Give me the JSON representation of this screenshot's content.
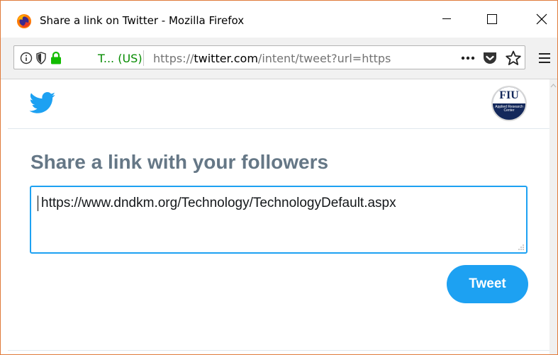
{
  "window": {
    "title": "Share a link on Twitter - Mozilla Firefox"
  },
  "navbar": {
    "site_identity": "T... (US)",
    "url_scheme": "https://",
    "url_host": "twitter.com",
    "url_path": "/intent/tweet?url=https",
    "icons": [
      "info-icon",
      "tracking-shield-icon",
      "lock-icon",
      "more-actions-icon",
      "pocket-icon",
      "bookmark-star-icon",
      "hamburger-menu-icon"
    ]
  },
  "page": {
    "logo": "twitter-bird-icon",
    "avatar_text": "FIU",
    "avatar_subtext": "Applied Research Center",
    "heading": "Share a link with your followers",
    "tweet_text": "https://www.dndkm.org/Technology/TechnologyDefault.aspx",
    "tweet_button": "Tweet"
  },
  "colors": {
    "twitter_blue": "#1da1f2",
    "heading_gray": "#657786",
    "secure_green": "#058b00",
    "window_border": "#e07a3a"
  }
}
